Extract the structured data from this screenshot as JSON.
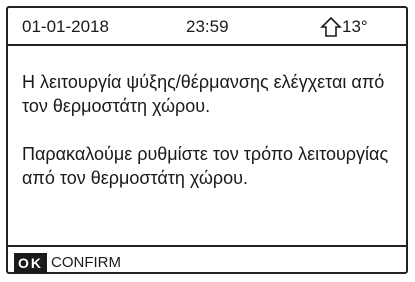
{
  "status_bar": {
    "date": "01-01-2018",
    "time": "23:59",
    "temperature": "13°",
    "home_icon": "house-outline-icon"
  },
  "message": {
    "line1": "Η λειτουργία ψύξης/θέρμανσης ελέγχεται από τον θερμοστάτη χώρου.",
    "line2": "Παρακαλούμε ρυθμίστε τον τρόπο λειτουργίας από τον θερμοστάτη χώρου."
  },
  "footer": {
    "ok_label": "OK",
    "confirm_label": "CONFIRM"
  }
}
